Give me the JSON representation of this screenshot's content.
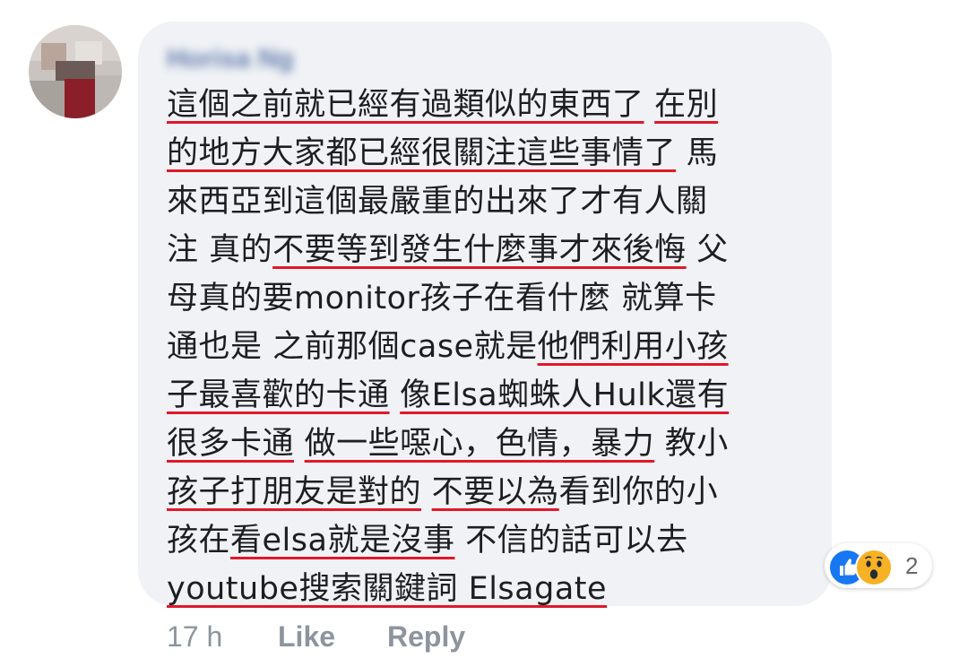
{
  "comment": {
    "author": "Horisa Ng",
    "lines": [
      [
        {
          "t": "這個之前就已經有過類似的東西了",
          "u": true
        },
        {
          "t": " ",
          "u": false
        },
        {
          "t": "在別",
          "u": true
        }
      ],
      [
        {
          "t": "的地方大家都已經很關注這些事情了",
          "u": true
        },
        {
          "t": " 馬",
          "u": false
        }
      ],
      [
        {
          "t": "來西亞到這個最嚴重的出來了才有人關",
          "u": false
        }
      ],
      [
        {
          "t": "注 真的",
          "u": false
        },
        {
          "t": "不要等到發生什麼事才來後悔",
          "u": true
        },
        {
          "t": " 父",
          "u": false
        }
      ],
      [
        {
          "t": "母真的要monitor孩子在看什麼 就算卡",
          "u": false
        }
      ],
      [
        {
          "t": "通也是 之前那個case就是",
          "u": false
        },
        {
          "t": "他們利用小孩",
          "u": true
        }
      ],
      [
        {
          "t": "子最喜歡的卡通",
          "u": true
        },
        {
          "t": " ",
          "u": false
        },
        {
          "t": "像Elsa蜘蛛人Hulk還有",
          "u": true
        }
      ],
      [
        {
          "t": "很多卡通",
          "u": true
        },
        {
          "t": " ",
          "u": false
        },
        {
          "t": "做一些噁心，色情，暴力",
          "u": true
        },
        {
          "t": " 教小",
          "u": false
        }
      ],
      [
        {
          "t": "孩子打朋友是對的",
          "u": true
        },
        {
          "t": " ",
          "u": false
        },
        {
          "t": "不要以為",
          "u": true
        },
        {
          "t": "看到你的小",
          "u": false
        }
      ],
      [
        {
          "t": "孩在",
          "u": false
        },
        {
          "t": "看elsa就是沒事",
          "u": true
        },
        {
          "t": " 不信的話可以去",
          "u": false
        }
      ],
      [
        {
          "t": "youtube搜索關鍵詞 Elsagate",
          "u": true
        }
      ]
    ],
    "underline_color": "#e0192a"
  },
  "reactions": {
    "icons": [
      "like-icon",
      "wow-icon"
    ],
    "count": "2",
    "like_color": "#1877f2",
    "wow_color": "#f7b125"
  },
  "actions": {
    "time": "17 h",
    "like": "Like",
    "reply": "Reply"
  }
}
